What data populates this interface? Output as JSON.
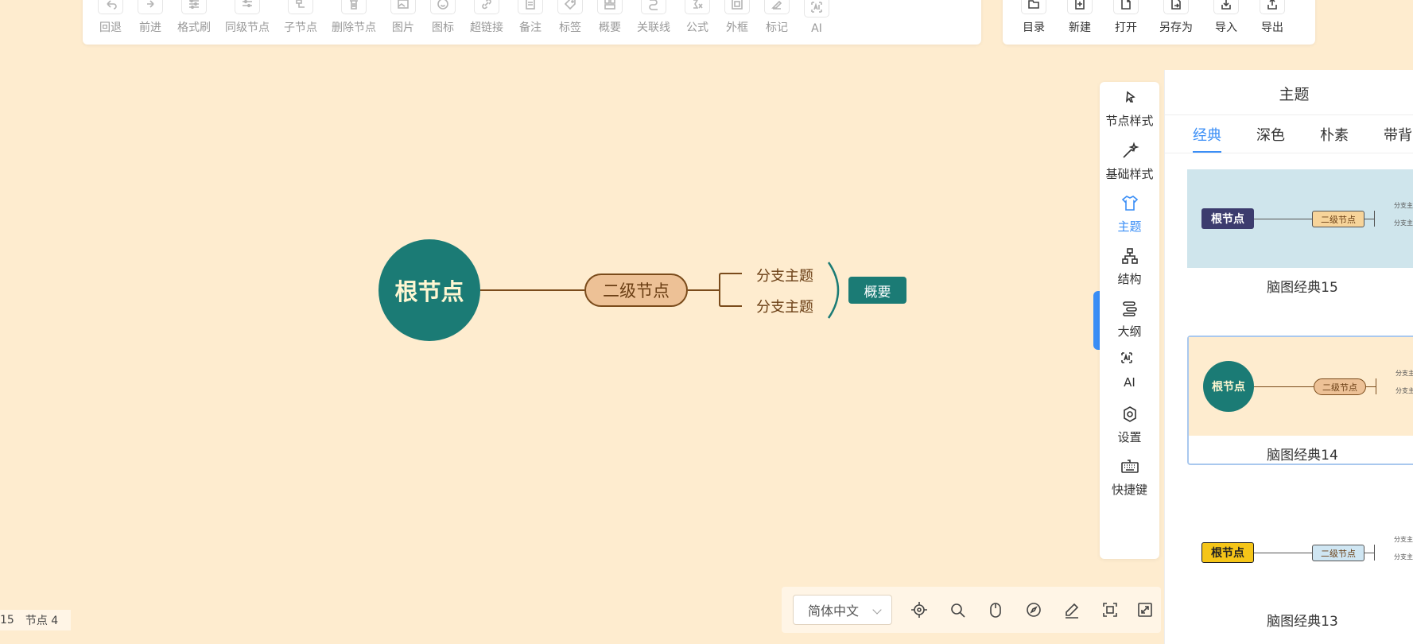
{
  "toolbar_left": [
    {
      "label": "回退",
      "icon": "undo-icon"
    },
    {
      "label": "前进",
      "icon": "redo-icon"
    },
    {
      "label": "格式刷",
      "icon": "format-painter-icon"
    },
    {
      "label": "同级节点",
      "icon": "sibling-node-icon"
    },
    {
      "label": "子节点",
      "icon": "child-node-icon"
    },
    {
      "label": "删除节点",
      "icon": "delete-node-icon"
    },
    {
      "label": "图片",
      "icon": "image-icon"
    },
    {
      "label": "图标",
      "icon": "emoji-icon"
    },
    {
      "label": "超链接",
      "icon": "link-icon"
    },
    {
      "label": "备注",
      "icon": "note-icon"
    },
    {
      "label": "标签",
      "icon": "tag-icon"
    },
    {
      "label": "概要",
      "icon": "summary-icon"
    },
    {
      "label": "关联线",
      "icon": "association-line-icon"
    },
    {
      "label": "公式",
      "icon": "formula-icon"
    },
    {
      "label": "外框",
      "icon": "outer-frame-icon"
    },
    {
      "label": "标记",
      "icon": "mark-icon"
    },
    {
      "label": "AI",
      "icon": "ai-icon"
    }
  ],
  "toolbar_right": [
    {
      "label": "目录",
      "icon": "directory-icon"
    },
    {
      "label": "新建",
      "icon": "new-file-icon"
    },
    {
      "label": "打开",
      "icon": "open-file-icon"
    },
    {
      "label": "另存为",
      "icon": "save-as-icon"
    },
    {
      "label": "导入",
      "icon": "import-icon"
    },
    {
      "label": "导出",
      "icon": "export-icon"
    }
  ],
  "mindmap": {
    "root": "根节点",
    "second": "二级节点",
    "branches": [
      "分支主题",
      "分支主题"
    ],
    "summary": "概要",
    "colors": {
      "root": "#1b7b75",
      "second_fill": "#edc196",
      "line": "#7a4b1b",
      "background": "#feeccf"
    }
  },
  "side_bar": [
    {
      "label": "节点样式",
      "icon": "node-style-icon",
      "active": false
    },
    {
      "label": "基础样式",
      "icon": "magic-wand-icon",
      "active": false
    },
    {
      "label": "主题",
      "icon": "shirt-icon",
      "active": true
    },
    {
      "label": "结构",
      "icon": "structure-icon",
      "active": false
    },
    {
      "label": "大纲",
      "icon": "outline-icon",
      "active": false
    },
    {
      "label": "AI",
      "icon": "ai-icon",
      "active": false
    },
    {
      "label": "设置",
      "icon": "settings-icon",
      "active": false
    },
    {
      "label": "快捷键",
      "icon": "keyboard-icon",
      "active": false
    }
  ],
  "theme_panel": {
    "title": "主题",
    "tabs": [
      "经典",
      "深色",
      "朴素",
      "带背"
    ],
    "active_tab": "经典",
    "themes": [
      {
        "name": "脑图经典15",
        "root": "根节点",
        "second": "二级节点",
        "branch": "分支主",
        "bg": "#cfe5ec",
        "root_bg": "#3c3c6e",
        "root_color": "#ffffff",
        "second_bg": "#f7d49a",
        "selected": false
      },
      {
        "name": "脑图经典14",
        "root": "根节点",
        "second": "二级节点",
        "branch": "分支主",
        "bg": "#feeccf",
        "root_bg": "#1b7b75",
        "root_color": "#fff7d2",
        "second_bg": "#edc196",
        "selected": true
      },
      {
        "name": "脑图经典13",
        "root": "根节点",
        "second": "二级节点",
        "branch": "分支主",
        "bg": "#ffffff",
        "root_bg": "#f5c518",
        "root_color": "#222222",
        "second_bg": "#cfe6f3",
        "selected": false
      }
    ]
  },
  "bottom_bar": {
    "language": "简体中文",
    "icons": [
      "locate-icon",
      "search-icon",
      "mouse-icon",
      "compass-icon",
      "edit-icon",
      "fit-screen-icon",
      "fullscreen-icon"
    ]
  },
  "status_bar": {
    "word_count": "15",
    "node_count": "节点 4"
  }
}
